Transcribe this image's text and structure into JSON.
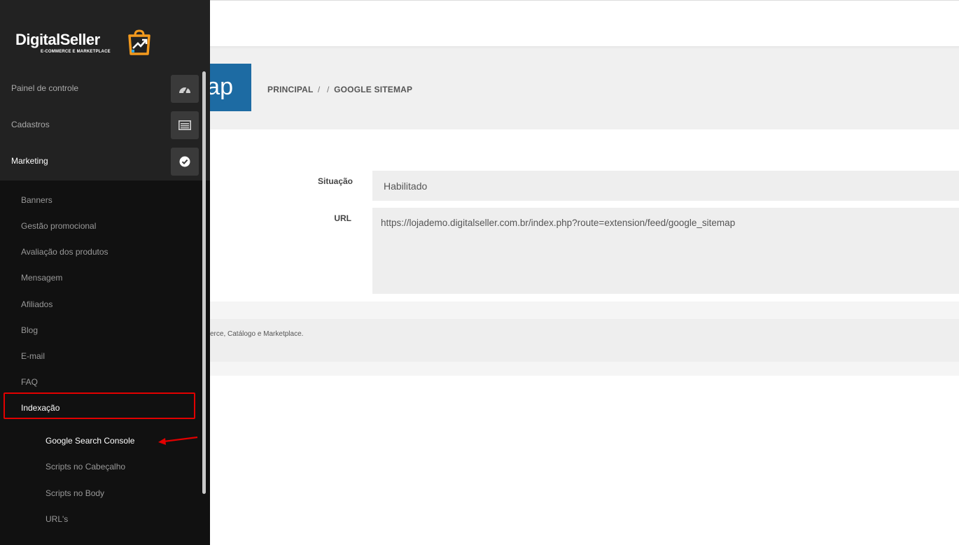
{
  "header": {
    "title_fragment": "ap",
    "breadcrumb": [
      "PRINCIPAL",
      "GOOGLE SITEMAP"
    ],
    "breadcrumb_separator": "/"
  },
  "form": {
    "situacao_label": "Situação",
    "situacao_value": "Habilitado",
    "url_label": "URL",
    "url_value": "https://lojademo.digitalseller.com.br/index.php?route=extension/feed/google_sitemap"
  },
  "footer": {
    "text": "erce, Catálogo e Marketplace."
  },
  "sidebar": {
    "logo": {
      "name": "DigitalSeller",
      "tagline": "E-COMMERCE E MARKETPLACE"
    },
    "top_items": [
      {
        "label": "Painel de controle",
        "icon": "dashboard-icon"
      },
      {
        "label": "Cadastros",
        "icon": "list-icon"
      },
      {
        "label": "Marketing",
        "icon": "check-circle-icon"
      }
    ],
    "marketing_items": [
      "Banners",
      "Gestão promocional",
      "Avaliação dos produtos",
      "Mensagem",
      "Afiliados",
      "Blog",
      "E-mail",
      "FAQ",
      "Indexação"
    ],
    "indexacao_items": [
      "Google Search Console",
      "Scripts no Cabeçalho",
      "Scripts no Body",
      "URL's"
    ]
  },
  "colors": {
    "sidebar_bg": "#111111",
    "title_blue": "#1d6ba3",
    "highlight_red": "#e20000",
    "logo_orange": "#f39a1e"
  }
}
